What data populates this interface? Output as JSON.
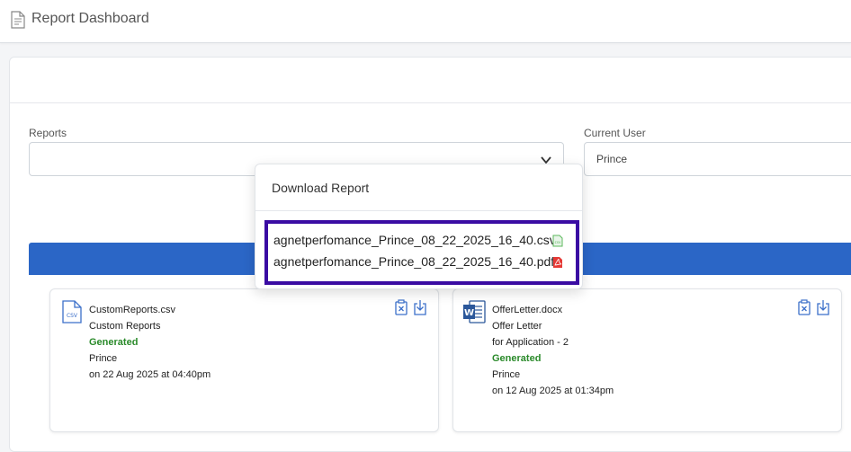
{
  "header": {
    "title": "Report Dashboard",
    "icon": "report-document-icon"
  },
  "filters": {
    "reports_label": "Reports",
    "reports_value": "",
    "current_user_label": "Current User",
    "current_user_value": "Prince"
  },
  "download_menu": {
    "title": "Download Report",
    "items": [
      {
        "label": "agnetperfomance_Prince_08_22_2025_16_40.csv",
        "icon": "csv-file-icon",
        "color": "#5cb85c"
      },
      {
        "label": "agnetperfomance_Prince_08_22_2025_16_40.pdf",
        "icon": "pdf-file-icon",
        "color": "#e53935"
      }
    ]
  },
  "cards": [
    {
      "filename": "CustomReports.csv",
      "report_name": "Custom Reports",
      "status": "Generated",
      "user": "Prince",
      "date": "on 22 Aug 2025 at 04:40pm",
      "icon": "csv-file-icon"
    },
    {
      "filename": "OfferLetter.docx",
      "report_name": "Offer Letter",
      "extra": "for Application - 2",
      "status": "Generated",
      "user": "Prince",
      "date": "on 12 Aug 2025 at 01:34pm",
      "icon": "word-file-icon"
    }
  ],
  "colors": {
    "accent_blue": "#2b66c6",
    "highlight": "#3a0ca3",
    "generated_green": "#2a8a2a"
  }
}
